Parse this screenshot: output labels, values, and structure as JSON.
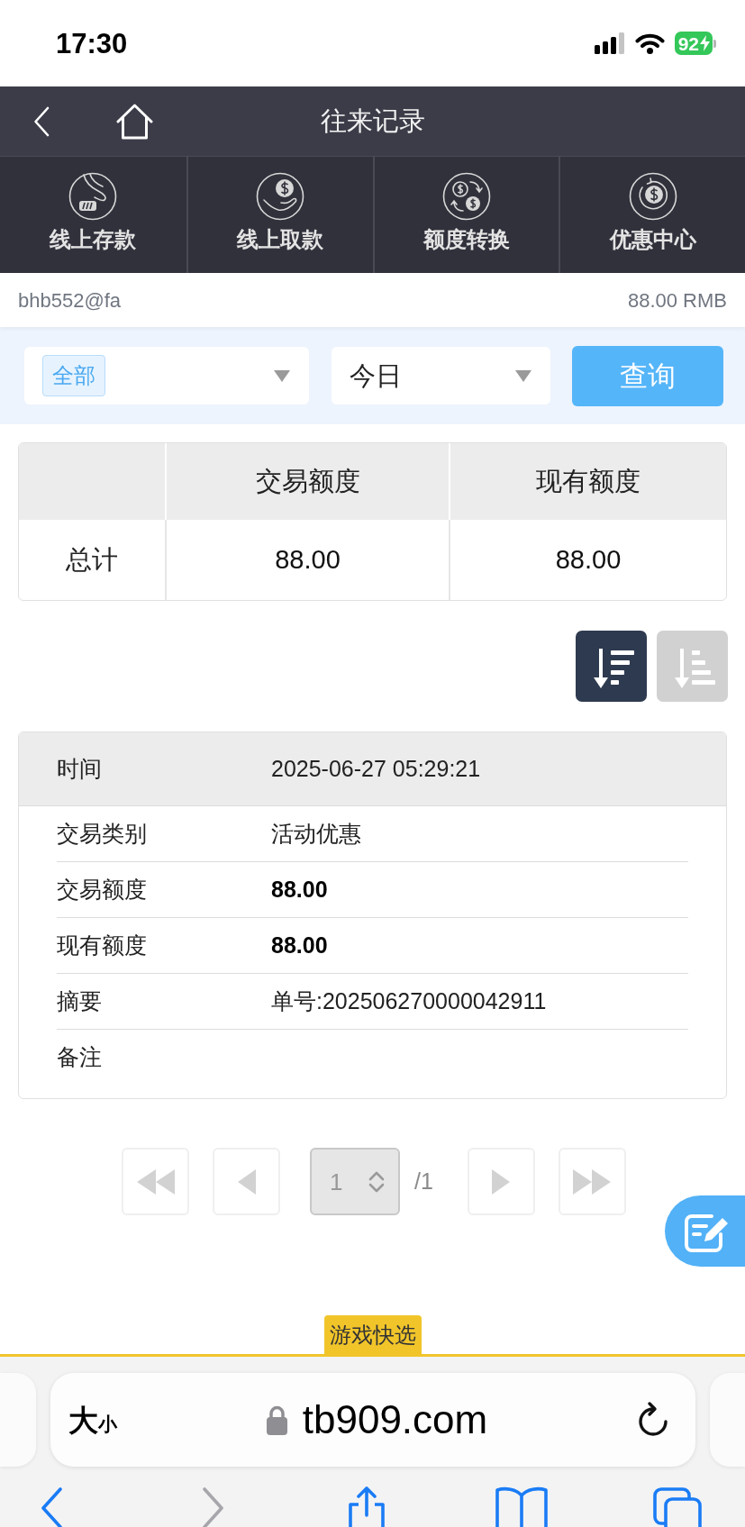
{
  "status_bar": {
    "time": "17:30",
    "battery": "92"
  },
  "header": {
    "title": "往来记录"
  },
  "nav": [
    {
      "label": "线上存款"
    },
    {
      "label": "线上取款"
    },
    {
      "label": "额度转换"
    },
    {
      "label": "优惠中心"
    }
  ],
  "account": {
    "user": "bhb552@fa",
    "balance": "88.00 RMB"
  },
  "filters": {
    "type_tag": "全部",
    "period": "今日",
    "query_button": "查询"
  },
  "summary": {
    "columns": [
      "交易额度",
      "现有额度"
    ],
    "rows": [
      {
        "label": "总计",
        "values": [
          "88.00",
          "88.00"
        ]
      }
    ]
  },
  "sort_buttons": [
    {
      "selected": true
    },
    {
      "selected": false
    }
  ],
  "record": {
    "header": {
      "label": "时间",
      "value": "2025-06-27 05:29:21"
    },
    "fields": [
      {
        "label": "交易类别",
        "value": "活动优惠",
        "kind": "text"
      },
      {
        "label": "交易额度",
        "value": "88.00",
        "kind": "amount"
      },
      {
        "label": "现有额度",
        "value": "88.00",
        "kind": "amount"
      },
      {
        "label": "摘要",
        "value": "单号:202506270000042911",
        "kind": "text"
      },
      {
        "label": "备注"
      }
    ]
  },
  "pagination": {
    "first": {
      "disabled": true
    },
    "prev": {
      "disabled": true
    },
    "page": "1",
    "total": "/1",
    "next": {
      "disabled": true
    },
    "last": {
      "disabled": true
    }
  },
  "quick_pick_tab": "游戏快选",
  "browser": {
    "text_size": {
      "large": "大",
      "small": "小"
    },
    "url": "tb909.com"
  }
}
